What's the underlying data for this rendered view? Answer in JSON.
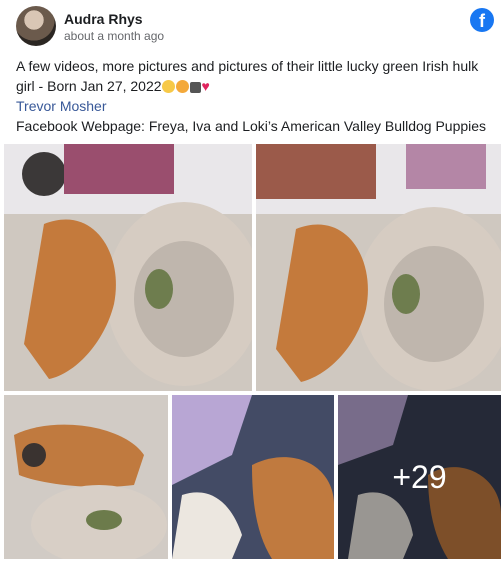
{
  "post": {
    "author": "Audra Rhys",
    "time": "about a month ago",
    "text_line1": "A few videos, more pictures and pictures of their little lucky green Irish hulk girl - Born Jan 27, 2022",
    "tag_name": "Trevor Mosher",
    "facebook_line": "Facebook Webpage: Freya, Iva and Loki’s American Valley Bulldog Puppies"
  },
  "icons": {
    "platform": "facebook-logo-icon",
    "emojis": [
      "rolling-laugh-emoji",
      "smiling-hearts-emoji",
      "paw-prints-emoji",
      "red-heart-emoji"
    ]
  },
  "gallery": {
    "more_count": "+29"
  },
  "colors": {
    "facebook_blue": "#1877f2",
    "link": "#385898",
    "secondary_text": "#65676b"
  }
}
